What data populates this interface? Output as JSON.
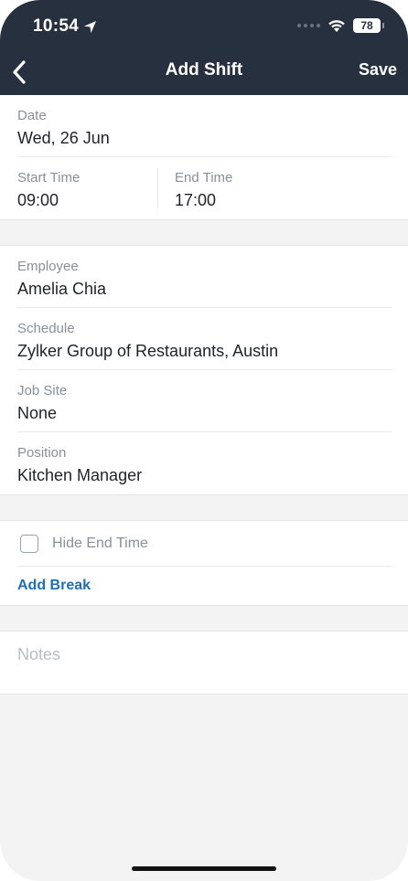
{
  "status_bar": {
    "time": "10:54",
    "battery": "78"
  },
  "nav": {
    "title": "Add Shift",
    "save_label": "Save",
    "back_icon": "chevron-left-icon"
  },
  "shift": {
    "date_label": "Date",
    "date_value": "Wed, 26 Jun",
    "start_label": "Start Time",
    "start_value": "09:00",
    "end_label": "End Time",
    "end_value": "17:00"
  },
  "details": [
    {
      "label": "Employee",
      "value": "Amelia Chia"
    },
    {
      "label": "Schedule",
      "value": "Zylker Group of Restaurants, Austin"
    },
    {
      "label": "Job Site",
      "value": "None"
    },
    {
      "label": "Position",
      "value": "Kitchen Manager"
    }
  ],
  "options": {
    "hide_end_time_label": "Hide End Time",
    "hide_end_time_checked": false,
    "add_break_label": "Add Break"
  },
  "notes": {
    "placeholder": "Notes",
    "value": ""
  },
  "colors": {
    "header_bg": "#27303f",
    "link": "#1f6fb5",
    "label": "#8a8f98"
  }
}
